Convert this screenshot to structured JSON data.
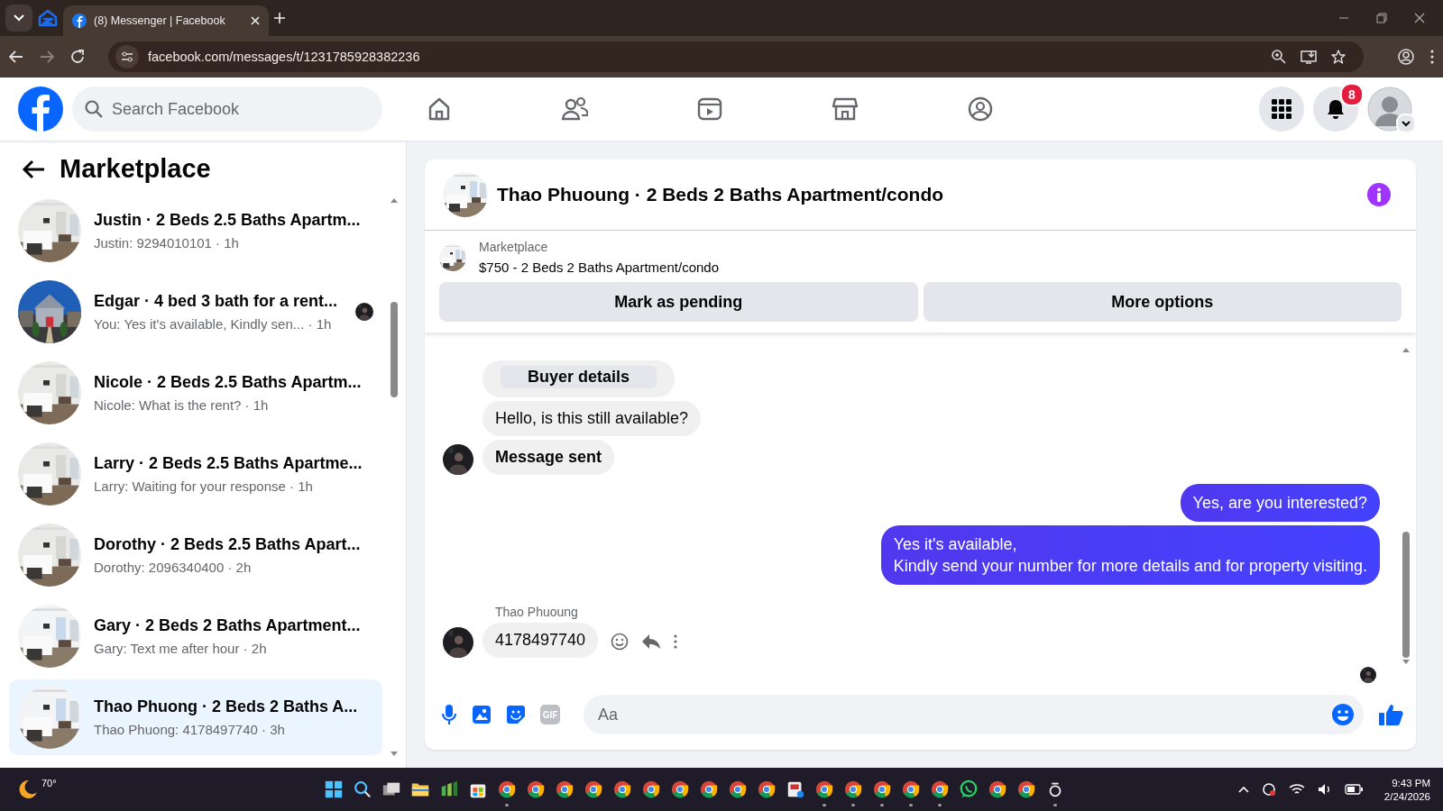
{
  "browser": {
    "tabs": [
      {
        "title": "(8) Messenger | Facebook",
        "selected": true
      }
    ],
    "url": "facebook.com/messages/t/1231785928382236"
  },
  "header": {
    "search": {
      "placeholder": "Search Facebook"
    },
    "nav": [
      {
        "kind": "home"
      },
      {
        "kind": "friends"
      },
      {
        "kind": "video"
      },
      {
        "kind": "marketplace"
      },
      {
        "kind": "gaming"
      }
    ],
    "notifications_badge": "8"
  },
  "sidebar": {
    "title": "Marketplace",
    "conversations": [
      {
        "title": "Justin · 2 Beds 2.5 Baths Apartm...",
        "preview": "Justin: 9294010101 · 1h",
        "seen": false,
        "selected": false
      },
      {
        "title": "Edgar · 4 bed 3 bath for a rent...",
        "preview": "You: Yes it's available, Kindly sen... · 1h",
        "seen": true,
        "selected": false
      },
      {
        "title": "Nicole · 2 Beds 2.5 Baths Apartm...",
        "preview": "Nicole: What is the rent? · 1h",
        "seen": false,
        "selected": false
      },
      {
        "title": "Larry · 2 Beds 2.5 Baths Apartme...",
        "preview": "Larry: Waiting for your response · 1h",
        "seen": false,
        "selected": false
      },
      {
        "title": "Dorothy · 2 Beds 2.5 Baths Apart...",
        "preview": "Dorothy: 2096340400 · 2h",
        "seen": false,
        "selected": false
      },
      {
        "title": "Gary · 2 Beds 2 Baths Apartment...",
        "preview": "Gary: Text me after hour · 2h",
        "seen": false,
        "selected": false
      },
      {
        "title": "Thao Phuong · 2 Beds 2 Baths A...",
        "preview": "Thao Phuong: 4178497740 · 3h",
        "seen": false,
        "selected": true
      }
    ]
  },
  "chat": {
    "title": "Thao Phuoung · 2 Beds 2 Baths Apartment/condo",
    "listing": {
      "label": "Marketplace",
      "name": "$750 - 2 Beds 2 Baths Apartment/condo",
      "actions": [
        "Mark as pending",
        "More options"
      ]
    },
    "messages": [
      {
        "kind": "card",
        "button": "Buyer details",
        "avatar": false
      },
      {
        "kind": "in",
        "text": "Hello, is this still available?",
        "emphasis": false,
        "avatar": false
      },
      {
        "kind": "in",
        "text": "Message sent",
        "emphasis": true,
        "avatar": true
      },
      {
        "kind": "out",
        "text": "Yes, are you interested?"
      },
      {
        "kind": "out",
        "text": "Yes it's available,\nKindly send your number for more details and for property visiting."
      },
      {
        "kind": "in",
        "sender": "Thao Phuoung",
        "text": "4178497740",
        "emphasis": false,
        "avatar": true,
        "actions": true
      }
    ],
    "seen": true,
    "composer": {
      "placeholder": "Aa",
      "gif": "GIF"
    }
  },
  "taskbar": {
    "weather": "70°",
    "apps": [
      {
        "kind": "start",
        "running": false
      },
      {
        "kind": "search",
        "running": false
      },
      {
        "kind": "taskview",
        "running": false
      },
      {
        "kind": "files",
        "running": false
      },
      {
        "kind": "sheets",
        "running": false
      },
      {
        "kind": "store",
        "running": false
      },
      {
        "kind": "chrome",
        "running": true
      },
      {
        "kind": "chrome",
        "running": false
      },
      {
        "kind": "chrome",
        "running": false
      },
      {
        "kind": "chrome",
        "running": false
      },
      {
        "kind": "chrome",
        "running": false
      },
      {
        "kind": "chrome",
        "running": false
      },
      {
        "kind": "chrome",
        "running": false
      },
      {
        "kind": "chrome",
        "running": false
      },
      {
        "kind": "chrome",
        "running": false
      },
      {
        "kind": "chrome",
        "running": false
      },
      {
        "kind": "redapp",
        "running": false
      },
      {
        "kind": "chrome",
        "running": true
      },
      {
        "kind": "chrome",
        "running": true
      },
      {
        "kind": "chrome",
        "running": true
      },
      {
        "kind": "chrome",
        "running": true
      },
      {
        "kind": "chrome",
        "running": true
      },
      {
        "kind": "whatsapp",
        "running": false
      },
      {
        "kind": "chrome",
        "running": false
      },
      {
        "kind": "chrome",
        "running": false
      },
      {
        "kind": "ring",
        "running": true
      }
    ],
    "time": "9:43 PM",
    "date": "2/24/2026"
  }
}
